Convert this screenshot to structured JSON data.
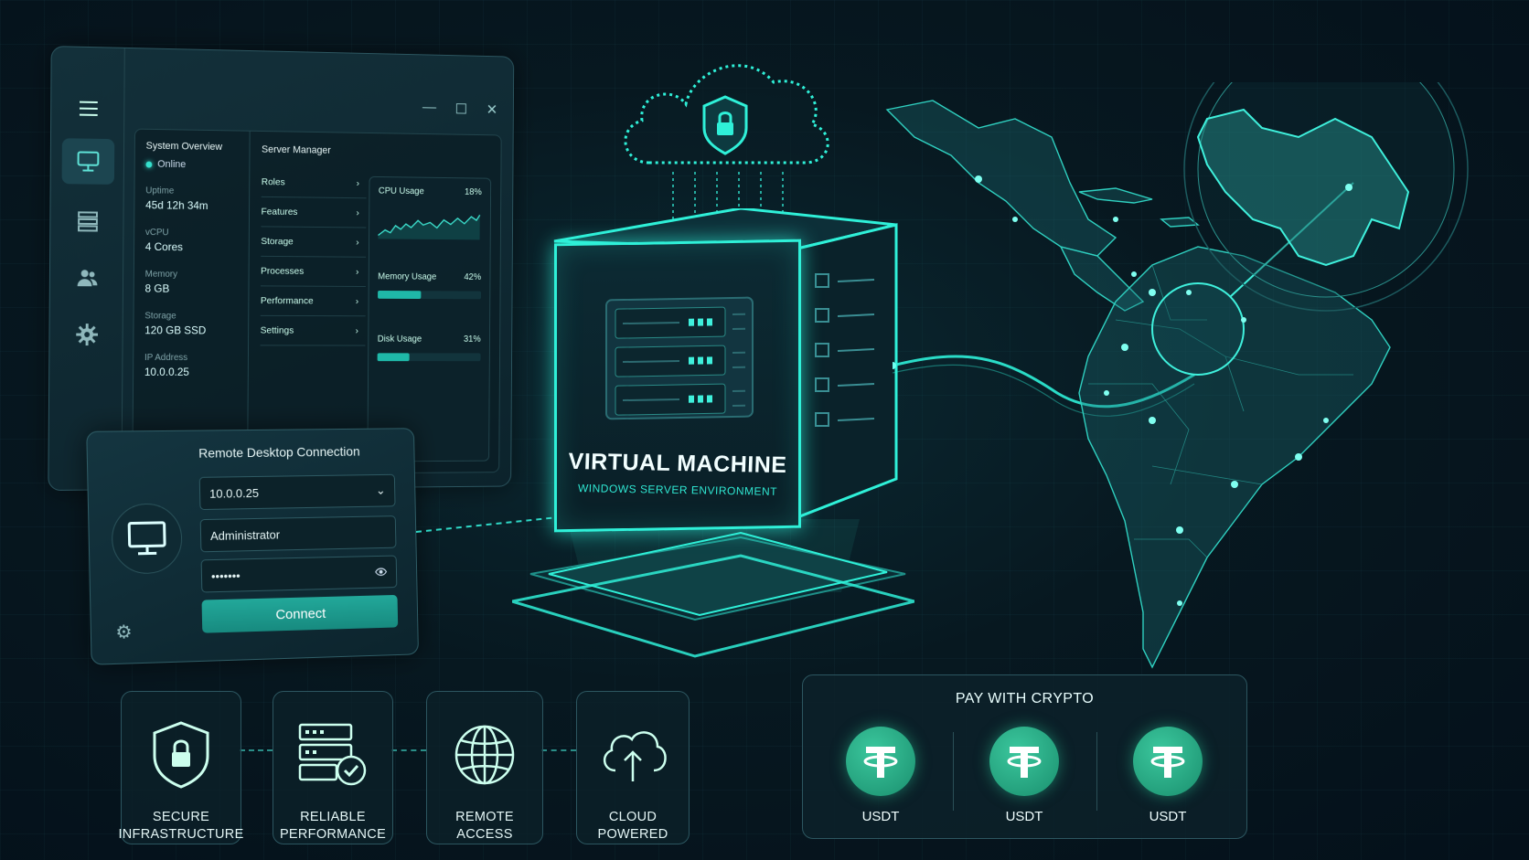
{
  "window": {
    "controls": [
      "—",
      "☐",
      "✕"
    ],
    "overview": {
      "title": "System Overview",
      "status": "Online",
      "stats": [
        {
          "label": "Uptime",
          "value": "45d 12h 34m"
        },
        {
          "label": "vCPU",
          "value": "4 Cores"
        },
        {
          "label": "Memory",
          "value": "8 GB"
        },
        {
          "label": "Storage",
          "value": "120 GB SSD"
        },
        {
          "label": "IP Address",
          "value": "10.0.0.25"
        }
      ]
    },
    "server_manager": {
      "title": "Server Manager",
      "items": [
        "Roles",
        "Features",
        "Storage",
        "Processes",
        "Performance",
        "Settings"
      ]
    },
    "usage": {
      "cpu": {
        "label": "CPU Usage",
        "value": "18%"
      },
      "memory": {
        "label": "Memory Usage",
        "value": "42%",
        "fraction": 0.42
      },
      "disk": {
        "label": "Disk Usage",
        "value": "31%",
        "fraction": 0.31
      }
    },
    "sidebar_icons": [
      "menu-icon",
      "monitor-icon",
      "server-icon",
      "users-icon",
      "gear-icon"
    ]
  },
  "rdp": {
    "title": "Remote Desktop Connection",
    "host": "10.0.0.25",
    "user": "Administrator",
    "password": "•••••••",
    "connect_label": "Connect"
  },
  "vm": {
    "title": "VIRTUAL MACHINE",
    "subtitle": "WINDOWS SERVER ENVIRONMENT"
  },
  "features": [
    {
      "line1": "SECURE",
      "line2": "INFRASTRUCTURE",
      "icon": "shield-lock-icon"
    },
    {
      "line1": "RELIABLE",
      "line2": "PERFORMANCE",
      "icon": "server-check-icon"
    },
    {
      "line1": "REMOTE",
      "line2": "ACCESS",
      "icon": "globe-icon"
    },
    {
      "line1": "CLOUD",
      "line2": "POWERED",
      "icon": "cloud-upload-icon"
    }
  ],
  "crypto": {
    "title": "PAY WITH CRYPTO",
    "coins": [
      "USDT",
      "USDT",
      "USDT"
    ]
  },
  "colors": {
    "accent": "#2ff0d8",
    "background": "#071820",
    "coin": "#26a17b"
  }
}
